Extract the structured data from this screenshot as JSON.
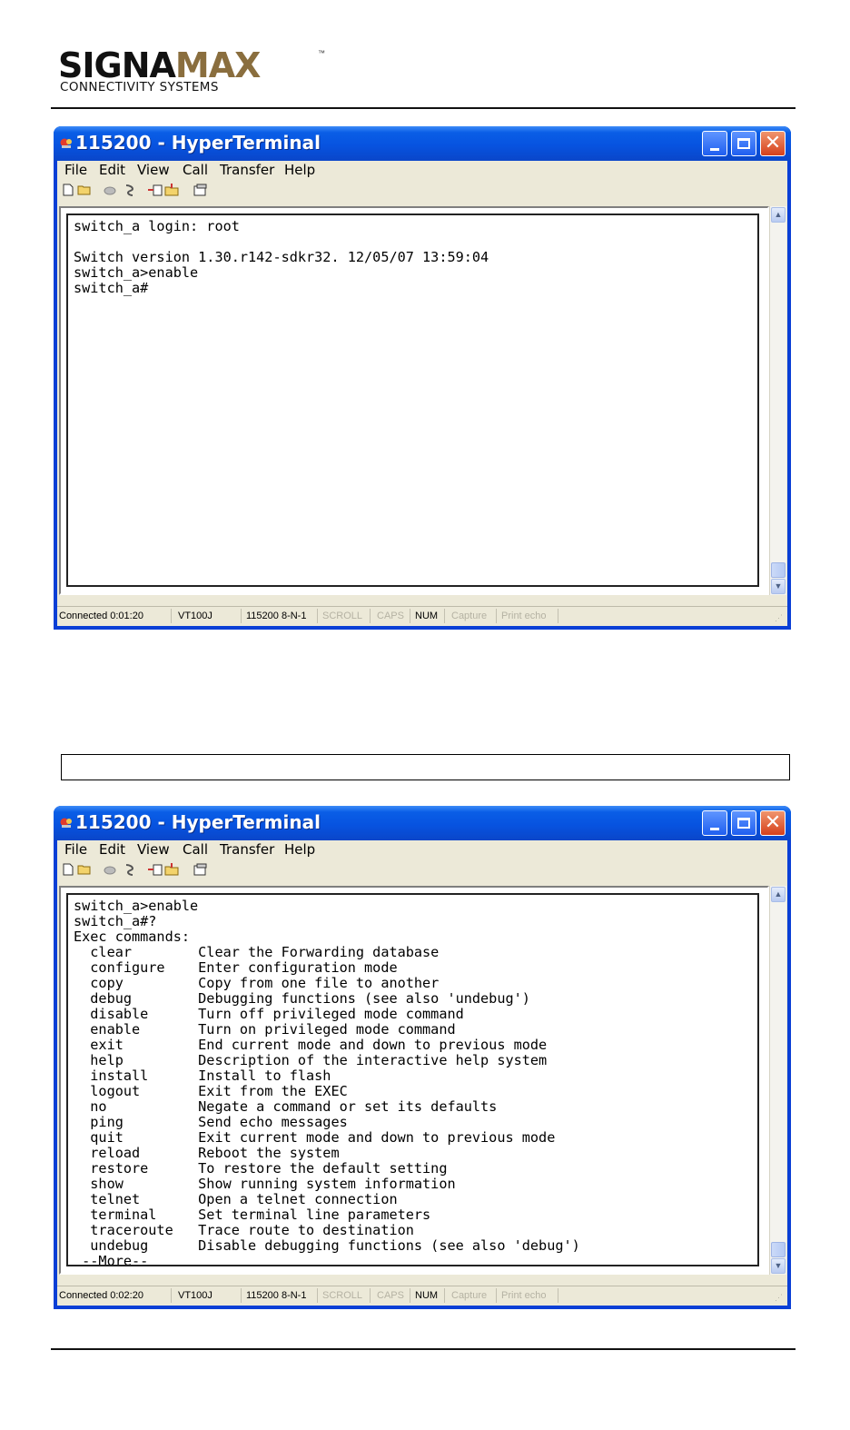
{
  "logo": {
    "brand_main": "SIGNA",
    "brand_accent": "MAX",
    "tm": "™",
    "tagline": "CONNECTIVITY SYSTEMS"
  },
  "windows": [
    {
      "title": "115200 - HyperTerminal",
      "menu": {
        "file": "File",
        "edit": "Edit",
        "view": "View",
        "call": "Call",
        "transfer": "Transfer",
        "help": "Help"
      },
      "terminal_lines": [
        "switch_a login: root",
        "",
        "Switch version 1.30.r142-sdkr32. 12/05/07 13:59:04",
        "switch_a>enable",
        "switch_a#"
      ],
      "status": {
        "connected": "Connected 0:01:20",
        "emulation": "VT100J",
        "settings": "115200 8-N-1",
        "scroll": "SCROLL",
        "caps": "CAPS",
        "num": "NUM",
        "capture": "Capture",
        "print_echo": "Print echo"
      }
    },
    {
      "title": "115200 - HyperTerminal",
      "menu": {
        "file": "File",
        "edit": "Edit",
        "view": "View",
        "call": "Call",
        "transfer": "Transfer",
        "help": "Help"
      },
      "terminal_lines": [
        "switch_a>enable",
        "switch_a#?",
        "Exec commands:",
        "  clear        Clear the Forwarding database",
        "  configure    Enter configuration mode",
        "  copy         Copy from one file to another",
        "  debug        Debugging functions (see also 'undebug')",
        "  disable      Turn off privileged mode command",
        "  enable       Turn on privileged mode command",
        "  exit         End current mode and down to previous mode",
        "  help         Description of the interactive help system",
        "  install      Install to flash",
        "  logout       Exit from the EXEC",
        "  no           Negate a command or set its defaults",
        "  ping         Send echo messages",
        "  quit         Exit current mode and down to previous mode",
        "  reload       Reboot the system",
        "  restore      To restore the default setting",
        "  show         Show running system information",
        "  telnet       Open a telnet connection",
        "  terminal     Set terminal line parameters",
        "  traceroute   Trace route to destination",
        "  undebug      Disable debugging functions (see also 'debug')",
        " --More-- _"
      ],
      "status": {
        "connected": "Connected 0:02:20",
        "emulation": "VT100J",
        "settings": "115200 8-N-1",
        "scroll": "SCROLL",
        "caps": "CAPS",
        "num": "NUM",
        "capture": "Capture",
        "print_echo": "Print echo"
      }
    }
  ],
  "colors": {
    "brand_accent": "#8a6e3e",
    "titlebar": "#0753e0",
    "close_button": "#d6401b"
  }
}
